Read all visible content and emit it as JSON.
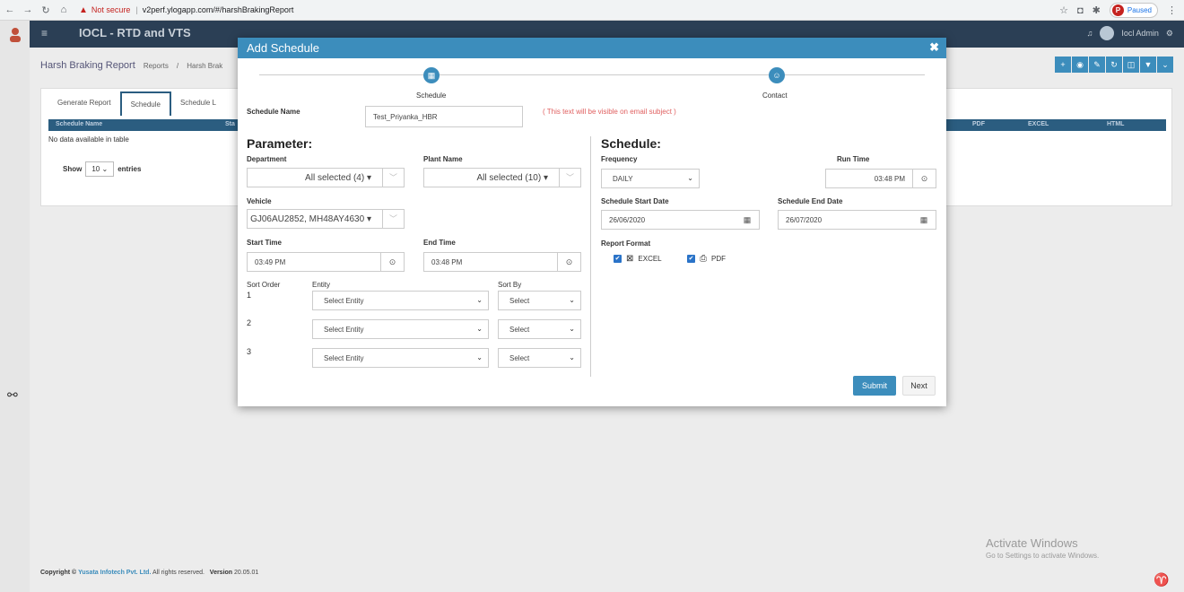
{
  "browser": {
    "not_secure": "Not secure",
    "url_sep": "|",
    "url": "v2perf.ylogapp.com/#/harshBrakingReport",
    "profile_initial": "P",
    "profile_status": "Paused"
  },
  "app": {
    "title": "IOCL - RTD and VTS",
    "user": "Iocl Admin"
  },
  "page": {
    "title": "Harsh Braking Report",
    "breadcrumb_reports": "Reports",
    "breadcrumb_sep": "/",
    "breadcrumb_current": "Harsh Brak"
  },
  "tabs": [
    "Generate Report",
    "Schedule",
    "Schedule L"
  ],
  "table": {
    "headers": [
      "Schedule Name",
      "Sta",
      "PDF",
      "EXCEL",
      "HTML"
    ],
    "empty": "No data available in table",
    "show": "Show",
    "entries_value": "10",
    "entries": "entries"
  },
  "modal": {
    "title": "Add Schedule",
    "steps": [
      "Schedule",
      "Contact"
    ],
    "schedule_name_label": "Schedule Name",
    "schedule_name_value": "Test_Priyanka_HBR",
    "schedule_name_hint": "( This text will be visible on email subject )",
    "parameter_title": "Parameter:",
    "department_label": "Department",
    "department_value": "All selected (4)",
    "plant_label": "Plant Name",
    "plant_value": "All selected (10)",
    "vehicle_label": "Vehicle",
    "vehicle_value": "GJ06AU2852, MH48AY4630",
    "start_time_label": "Start Time",
    "start_time_value": "03:49 PM",
    "end_time_label": "End Time",
    "end_time_value": "03:48 PM",
    "sort_order_label": "Sort Order",
    "entity_label": "Entity",
    "sort_by_label": "Sort By",
    "sort_rows": [
      {
        "num": "1",
        "entity": "Select Entity",
        "sort": "Select"
      },
      {
        "num": "2",
        "entity": "Select Entity",
        "sort": "Select"
      },
      {
        "num": "3",
        "entity": "Select Entity",
        "sort": "Select"
      }
    ],
    "schedule_title": "Schedule:",
    "frequency_label": "Frequency",
    "frequency_value": "DAILY",
    "run_time_label": "Run Time",
    "run_time_value": "03:48 PM",
    "start_date_label": "Schedule Start Date",
    "start_date_value": "26/06/2020",
    "end_date_label": "Schedule End Date",
    "end_date_value": "26/07/2020",
    "report_format_label": "Report Format",
    "format_excel": "EXCEL",
    "format_pdf": "PDF",
    "submit": "Submit",
    "next": "Next"
  },
  "footer": {
    "copyright": "Copyright ©",
    "company": "Yusata Infotech Pvt. Ltd.",
    "rights": "All rights reserved.",
    "version_label": "Version",
    "version": "20.05.01"
  },
  "windows": {
    "activate": "Activate Windows",
    "goto": "Go to Settings to activate Windows."
  },
  "colors": {
    "primary": "#3c8dbc",
    "header": "#2b3f55",
    "hint": "#e06060"
  }
}
